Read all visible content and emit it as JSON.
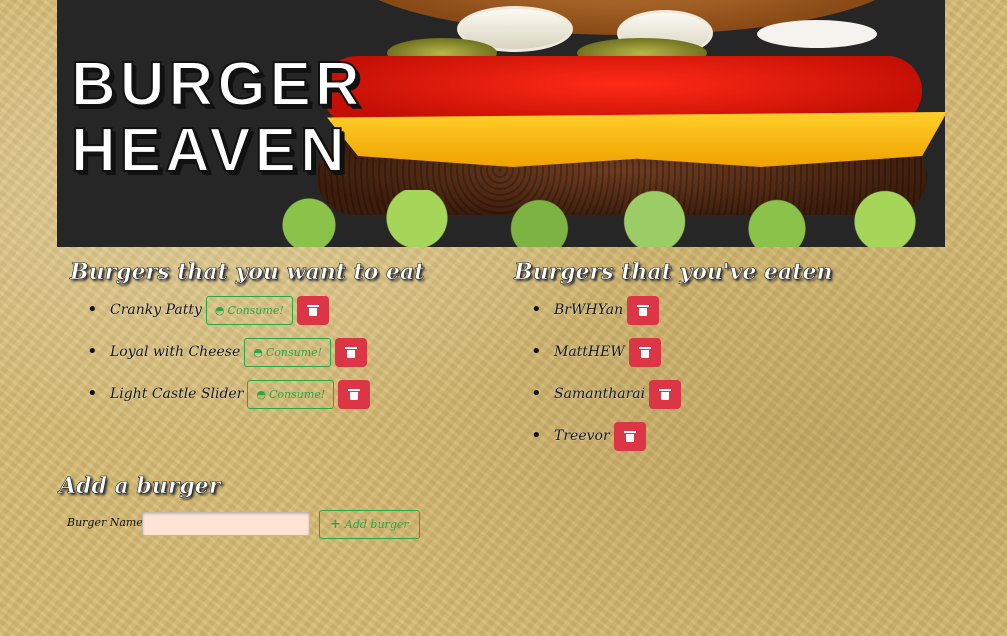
{
  "hero": {
    "title_line1": "BURGER",
    "title_line2": "HEAVEN"
  },
  "to_eat": {
    "heading": "Burgers that you want to eat",
    "consume_label": "Consume!",
    "items": [
      {
        "name": "Cranky Patty"
      },
      {
        "name": "Loyal with Cheese"
      },
      {
        "name": "Light Castle Slider"
      }
    ]
  },
  "eaten": {
    "heading": "Burgers that you've eaten",
    "items": [
      {
        "name": "BrWHYan"
      },
      {
        "name": "MattHEW"
      },
      {
        "name": "Samantharai"
      },
      {
        "name": "Treevor"
      }
    ]
  },
  "add_form": {
    "heading": "Add a burger",
    "label": "Burger Name:",
    "input_value": "",
    "button_label": "Add burger"
  },
  "icons": {
    "consume": "cookie-icon",
    "delete": "trash-icon",
    "add": "plus-icon"
  },
  "colors": {
    "consume_green": "#28a745",
    "delete_red": "#dc3545",
    "input_bg": "#ffe3d4"
  }
}
